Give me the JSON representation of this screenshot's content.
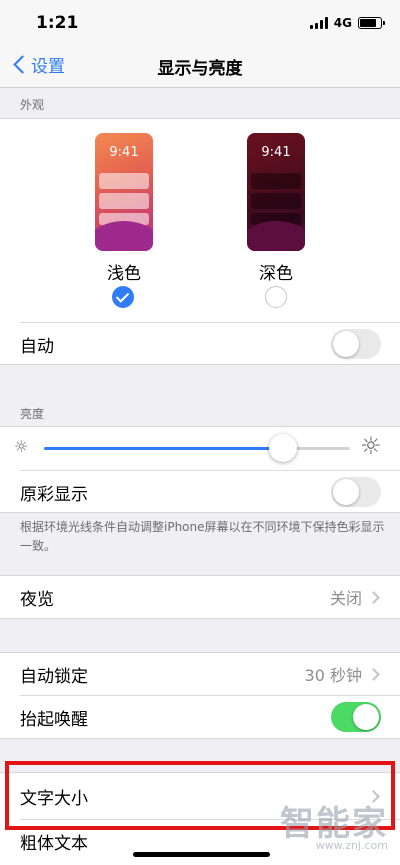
{
  "status_bar": {
    "time": "1:21",
    "network": "4G"
  },
  "nav": {
    "back_label": "设置",
    "title": "显示与亮度"
  },
  "appearance": {
    "header": "外观",
    "light": {
      "phone_time": "9:41",
      "label": "浅色",
      "selected": true
    },
    "dark": {
      "phone_time": "9:41",
      "label": "深色",
      "selected": false
    },
    "auto_label": "自动",
    "auto_on": false
  },
  "brightness": {
    "header": "亮度",
    "level": 0.78,
    "true_tone_label": "原彩显示",
    "true_tone_on": false,
    "footer": "根据环境光线条件自动调整iPhone屏幕以在不同环境下保持色彩显示一致。"
  },
  "night_shift": {
    "label": "夜览",
    "value": "关闭"
  },
  "lock": {
    "auto_lock_label": "自动锁定",
    "auto_lock_value": "30 秒钟",
    "raise_to_wake_label": "抬起唤醒",
    "raise_to_wake_on": true
  },
  "text": {
    "text_size_label": "文字大小",
    "bold_text_label": "粗体文本"
  },
  "watermark": {
    "main": "智能家",
    "sub": "www.znj.com"
  },
  "colors": {
    "accent": "#2f7cf6",
    "toggle_on": "#4cd964",
    "highlight": "#e31414"
  }
}
